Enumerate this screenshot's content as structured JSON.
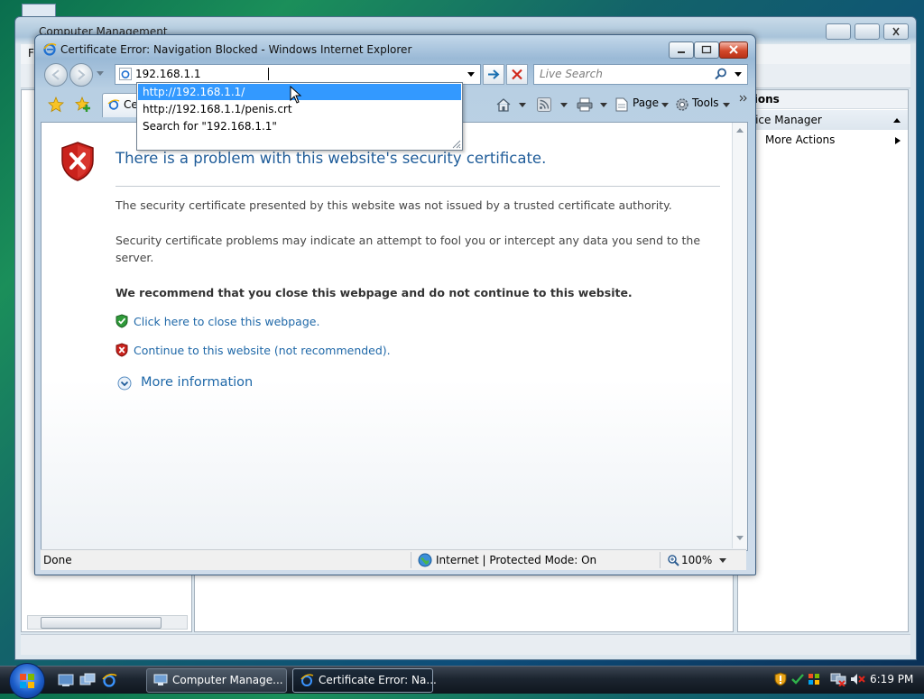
{
  "background_window": {
    "title": "Computer Management",
    "menu_letter": "F",
    "actions_header": "tions",
    "device_manager_label": "vice Manager",
    "more_actions_label": "More Actions"
  },
  "ie": {
    "title": "Certificate Error: Navigation Blocked - Windows Internet Explorer",
    "address": "192.168.1.1",
    "search_placeholder": "Live Search",
    "tab_label": "Ce",
    "autocomplete": [
      "http://192.168.1.1/",
      "http://192.168.1.1/penis.crt",
      "Search for \"192.168.1.1\""
    ],
    "commands": {
      "page": "Page",
      "tools": "Tools"
    },
    "content": {
      "heading": "There is a problem with this website's security certificate.",
      "para1": "The security certificate presented by this website was not issued by a trusted certificate authority.",
      "para2": "Security certificate problems may indicate an attempt to fool you or intercept any data you send to the server.",
      "recommend": "We recommend that you close this webpage and do not continue to this website.",
      "close_link": "Click here to close this webpage.",
      "continue_link": "Continue to this website (not recommended).",
      "more_info": "More information"
    },
    "status": {
      "left": "Done",
      "zone": "Internet | Protected Mode: On",
      "zoom": "100%"
    }
  },
  "taskbar": {
    "buttons": [
      "Computer Manage...",
      "Certificate Error: Na..."
    ],
    "clock": "6:19 PM"
  },
  "colors": {
    "link": "#1f68a8",
    "heading": "#1f5c99",
    "selection": "#3399ff"
  }
}
